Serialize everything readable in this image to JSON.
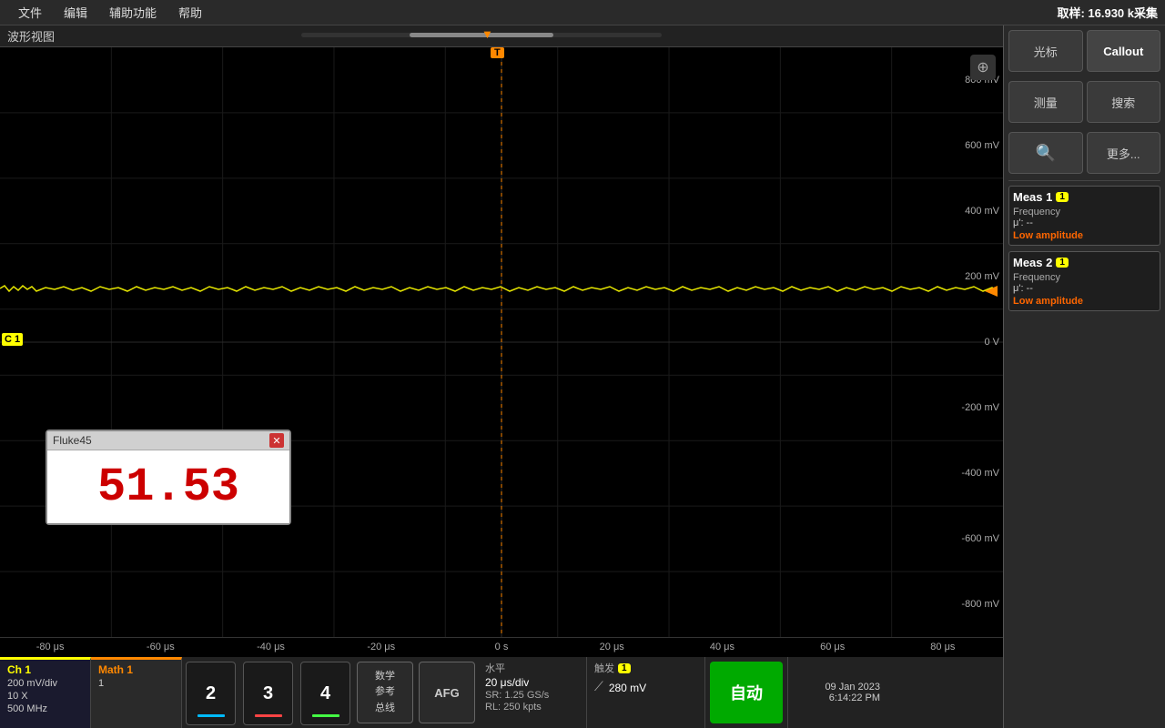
{
  "menubar": {
    "items": [
      "文件",
      "编辑",
      "辅助功能",
      "帮助"
    ],
    "status": "取样: 16.930 k采集"
  },
  "waveform": {
    "title": "波形视图",
    "y_labels": [
      "800 mV",
      "600 mV",
      "400 mV",
      "200 mV",
      "0 V",
      "-200 mV",
      "-400 mV",
      "-600 mV",
      "-800 mV"
    ],
    "x_labels": [
      "-80 μs",
      "-60 μs",
      "-40 μs",
      "-20 μs",
      "0 s",
      "20 μs",
      "40 μs",
      "60 μs",
      "80 μs"
    ],
    "c1_label": "C 1"
  },
  "right_panel": {
    "btn_cursor": "光标",
    "btn_callout": "Callout",
    "btn_measure": "测量",
    "btn_search": "搜索",
    "btn_zoom": "🔍",
    "btn_more": "更多..."
  },
  "meas1": {
    "title": "Meas 1",
    "badge": "1",
    "param1": "Frequency",
    "value1": "μ': --",
    "status": "Low amplitude"
  },
  "meas2": {
    "title": "Meas 2",
    "badge": "1",
    "param1": "Frequency",
    "value1": "μ': --",
    "status": "Low amplitude"
  },
  "fluke": {
    "title": "Fluke45",
    "value": "51.53",
    "close": "✕"
  },
  "bottom": {
    "ch1_name": "Ch 1",
    "ch1_line1": "200 mV/div",
    "ch1_line2": "10 X",
    "ch1_line3": "500 MHz",
    "math1_name": "Math 1",
    "math1_val": "1",
    "btn2": "2",
    "btn3": "3",
    "btn4": "4",
    "btn_math": "数学\n参考\n总线",
    "btn_afg": "AFG",
    "horiz_title": "水平",
    "horiz_div": "20 μs/div",
    "horiz_sr": "SR: 1.25 GS/s",
    "horiz_rl": "RL: 250 kpts",
    "trig_title": "触发",
    "trig_badge": "1",
    "trig_symbol": "⟋",
    "trig_val": "280 mV",
    "auto_btn": "自动",
    "date": "09 Jan 2023",
    "time": "6:14:22 PM"
  }
}
